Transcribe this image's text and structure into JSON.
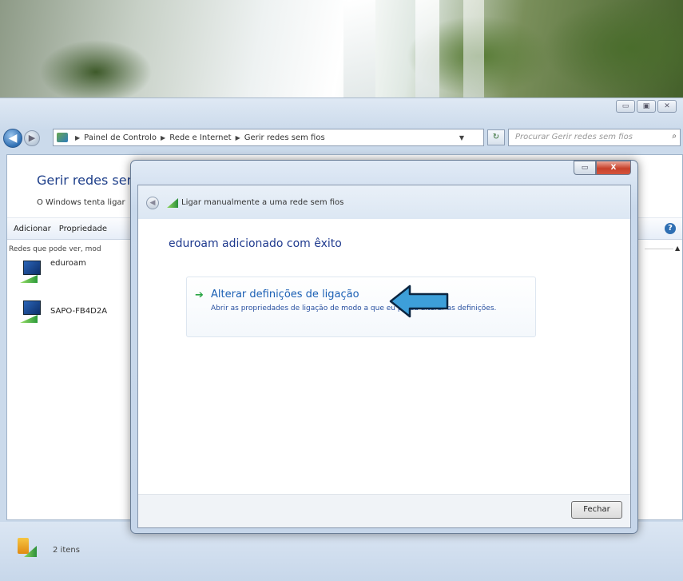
{
  "explorer": {
    "window_controls": [
      "▭",
      "▣",
      "✕"
    ],
    "breadcrumb": [
      "Painel de Controlo",
      "Rede e Internet",
      "Gerir redes sem fios"
    ],
    "search_placeholder": "Procurar Gerir redes sem fios",
    "page_title": "Gerir redes sem",
    "subtitle": "O Windows tenta ligar",
    "commands": [
      "Adicionar",
      "Propriedade"
    ],
    "list_header": "Redes que pode ver, mod",
    "networks": [
      "eduroam",
      "SAPO-FB4D2A"
    ],
    "status_text": "2 itens"
  },
  "dialog": {
    "title": "Ligar manualmente a uma rede sem fios",
    "heading": "eduroam adicionado com êxito",
    "task_title": "Alterar definições de ligação",
    "task_description": "Abrir as propriedades de ligação de modo a que eu possa alterar as definições.",
    "close_button": "Fechar",
    "controls": [
      "▭",
      "X"
    ]
  }
}
